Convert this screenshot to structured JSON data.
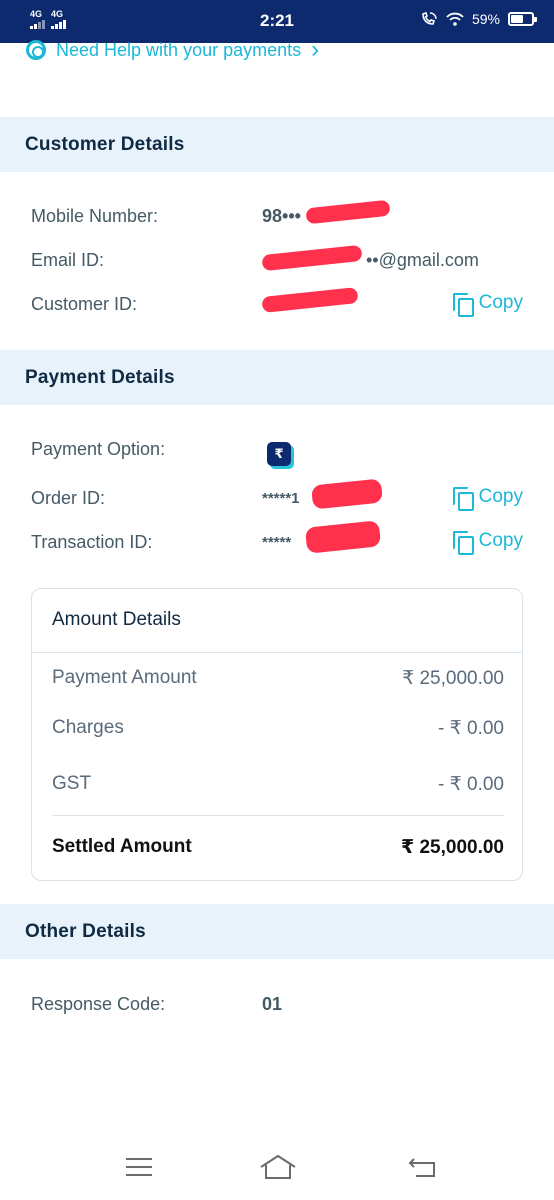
{
  "status_bar": {
    "network_1": "4G",
    "network_2": "4G",
    "time": "2:21",
    "battery": "59%",
    "battery_level": 0.59
  },
  "help_link": {
    "label": "Need Help with your payments",
    "chevron": "›"
  },
  "customer_details": {
    "title": "Customer Details",
    "mobile_label": "Mobile Number:",
    "mobile_value": "98•••",
    "email_label": "Email ID:",
    "email_value": "••@gmail.com",
    "customer_id_label": "Customer ID:",
    "customer_id_value": "",
    "copy_label": "Copy"
  },
  "payment_details": {
    "title": "Payment Details",
    "option_label": "Payment Option:",
    "option_icon": "rupee-wallet-icon",
    "option_icon_glyph": "₹",
    "order_label": "Order ID:",
    "order_value": "*****1",
    "transaction_label": "Transaction ID:",
    "transaction_value": "*****",
    "copy_label": "Copy"
  },
  "amount_details": {
    "title": "Amount Details",
    "payment_amount_label": "Payment Amount",
    "payment_amount_value": "₹ 25,000.00",
    "charges_label": "Charges",
    "charges_value": "- ₹ 0.00",
    "gst_label": "GST",
    "gst_value": "- ₹ 0.00",
    "settled_label": "Settled Amount",
    "settled_value": "₹ 25,000.00"
  },
  "other_details": {
    "title": "Other Details",
    "response_label": "Response Code:",
    "response_value": "01"
  },
  "colors": {
    "status_bar": "#0d2a6e",
    "accent": "#1db7d8",
    "section_bg": "#e8f2fb",
    "heading": "#102a43",
    "redaction": "#ff1f3d"
  }
}
